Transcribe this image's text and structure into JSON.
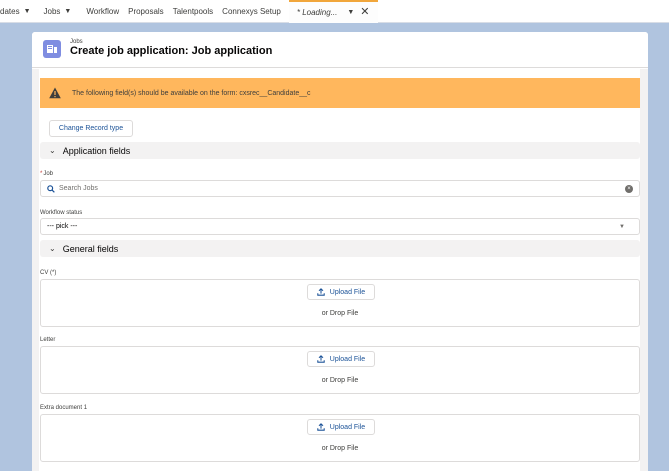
{
  "nav": {
    "items": [
      {
        "label": "dates",
        "has_menu": true
      },
      {
        "label": "Jobs",
        "has_menu": true
      },
      {
        "label": "Workflow",
        "has_menu": false
      },
      {
        "label": "Proposals",
        "has_menu": false
      },
      {
        "label": "Talentpools",
        "has_menu": false
      },
      {
        "label": "Connexys Setup",
        "has_menu": false
      }
    ],
    "active_tab": {
      "label": "* Loading...",
      "close": "✕"
    }
  },
  "header": {
    "object_label": "Jobs",
    "title": "Create job application: Job application",
    "icon": "jobs-icon"
  },
  "warning": {
    "text": "The following field(s) should be available on the form: cxsrec__Candidate__c",
    "icon": "warning-icon"
  },
  "buttons": {
    "change_record_type": "Change Record type"
  },
  "sections": {
    "application": "Application fields",
    "general": "General fields"
  },
  "fields": {
    "job": {
      "required_mark": "*",
      "label": "Job",
      "placeholder": "Search Jobs"
    },
    "workflow": {
      "label": "Workflow status",
      "value": "--- pick ---"
    }
  },
  "uploads": [
    {
      "label": "CV (*)",
      "button": "Upload File",
      "drop_text": "or Drop File"
    },
    {
      "label": "Letter",
      "button": "Upload File",
      "drop_text": "or Drop File"
    },
    {
      "label": "Extra document 1",
      "button": "Upload File",
      "drop_text": "or Drop File"
    }
  ],
  "colors": {
    "nav_active_accent": "#f1a63b",
    "warning_bg": "#ffb75d",
    "brand_blue": "#1b5297",
    "page_bg": "#b0c4df",
    "object_icon": "#7f8de1"
  }
}
